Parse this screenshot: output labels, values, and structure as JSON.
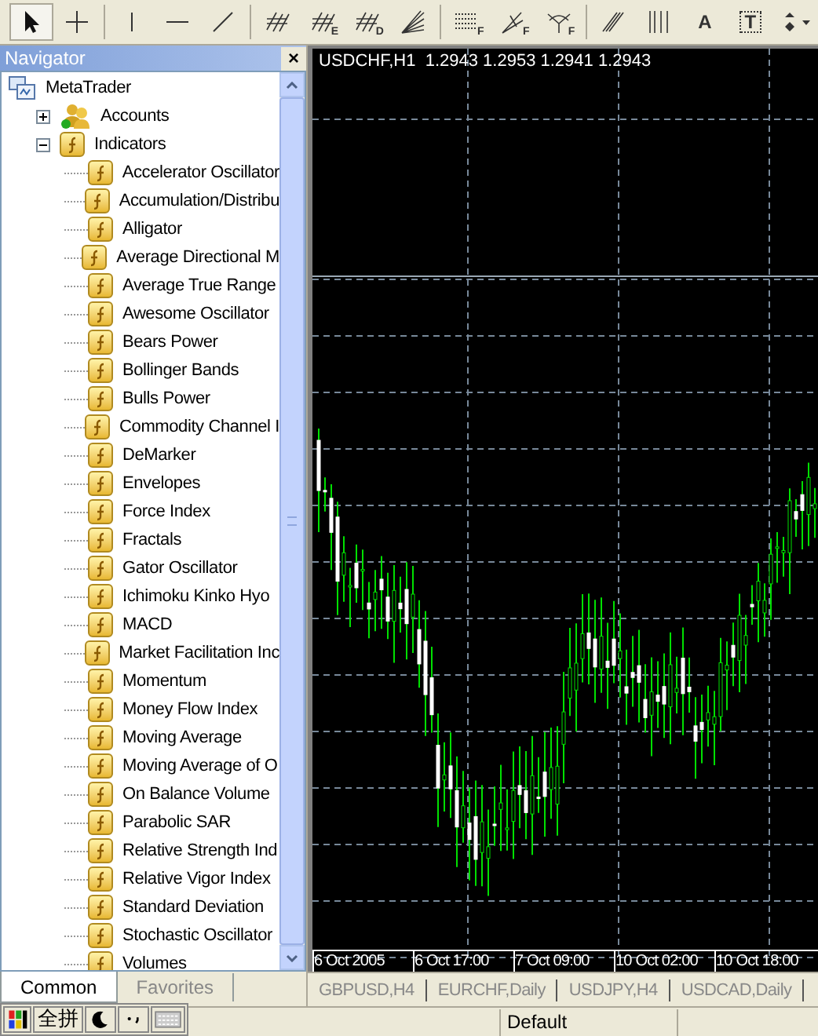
{
  "toolbar": [
    {
      "selected": true
    },
    {
      "selected": false
    },
    {
      "selected": false
    },
    {
      "selected": false
    },
    {
      "selected": false
    },
    {
      "selected": false
    },
    {
      "selected": false,
      "mark": "E"
    },
    {
      "selected": false,
      "mark": "D"
    },
    {
      "selected": false
    },
    {
      "selected": false,
      "mark": "F"
    },
    {
      "selected": false,
      "mark": "F"
    },
    {
      "selected": false,
      "mark": "F"
    },
    {
      "selected": false
    },
    {
      "selected": false
    },
    {
      "selected": false,
      "mark": "A"
    },
    {
      "selected": false,
      "mark": "T"
    },
    {
      "selected": false
    }
  ],
  "navigator": {
    "title": "Navigator",
    "close": "×",
    "tree": [
      {
        "label": "MetaTrader",
        "kind": "root",
        "children": [
          {
            "label": "Accounts",
            "kind": "accounts",
            "expanded": false
          },
          {
            "label": "Indicators",
            "kind": "folder",
            "expanded": true,
            "children": [
              {
                "label": "Accelerator Oscillator",
                "kind": "indicator"
              },
              {
                "label": "Accumulation/Distribu",
                "kind": "indicator"
              },
              {
                "label": "Alligator",
                "kind": "indicator"
              },
              {
                "label": "Average Directional M",
                "kind": "indicator"
              },
              {
                "label": "Average True Range",
                "kind": "indicator"
              },
              {
                "label": "Awesome Oscillator",
                "kind": "indicator"
              },
              {
                "label": "Bears Power",
                "kind": "indicator"
              },
              {
                "label": "Bollinger Bands",
                "kind": "indicator"
              },
              {
                "label": "Bulls Power",
                "kind": "indicator"
              },
              {
                "label": "Commodity Channel I",
                "kind": "indicator"
              },
              {
                "label": "DeMarker",
                "kind": "indicator"
              },
              {
                "label": "Envelopes",
                "kind": "indicator"
              },
              {
                "label": "Force Index",
                "kind": "indicator"
              },
              {
                "label": "Fractals",
                "kind": "indicator"
              },
              {
                "label": "Gator Oscillator",
                "kind": "indicator"
              },
              {
                "label": "Ichimoku Kinko Hyo",
                "kind": "indicator"
              },
              {
                "label": "MACD",
                "kind": "indicator"
              },
              {
                "label": "Market Facilitation Inc",
                "kind": "indicator"
              },
              {
                "label": "Momentum",
                "kind": "indicator"
              },
              {
                "label": "Money Flow Index",
                "kind": "indicator"
              },
              {
                "label": "Moving Average",
                "kind": "indicator"
              },
              {
                "label": "Moving Average of O",
                "kind": "indicator"
              },
              {
                "label": "On Balance Volume",
                "kind": "indicator"
              },
              {
                "label": "Parabolic SAR",
                "kind": "indicator"
              },
              {
                "label": "Relative Strength Ind",
                "kind": "indicator"
              },
              {
                "label": "Relative Vigor Index",
                "kind": "indicator"
              },
              {
                "label": "Standard Deviation",
                "kind": "indicator"
              },
              {
                "label": "Stochastic Oscillator",
                "kind": "indicator"
              },
              {
                "label": "Volumes",
                "kind": "indicator"
              }
            ]
          }
        ]
      }
    ],
    "tabs": [
      {
        "label": "Common",
        "selected": true
      },
      {
        "label": "Favorites",
        "selected": false
      }
    ]
  },
  "chart": {
    "header": "USDCHF,H1  1.2943 1.2953 1.2941 1.2943",
    "time_labels": [
      "6 Oct 2005",
      "6 Oct 17:00",
      "7 Oct 09:00",
      "10 Oct 02:00",
      "10 Oct 18:00"
    ]
  },
  "chart_tabs": [
    {
      "label": "GBPUSD,H4"
    },
    {
      "label": "EURCHF,Daily"
    },
    {
      "label": "USDJPY,H4"
    },
    {
      "label": "USDCAD,Daily"
    }
  ],
  "ime_bar": {
    "mode": "全拼"
  },
  "status_bar": {
    "profile": "Default"
  }
}
